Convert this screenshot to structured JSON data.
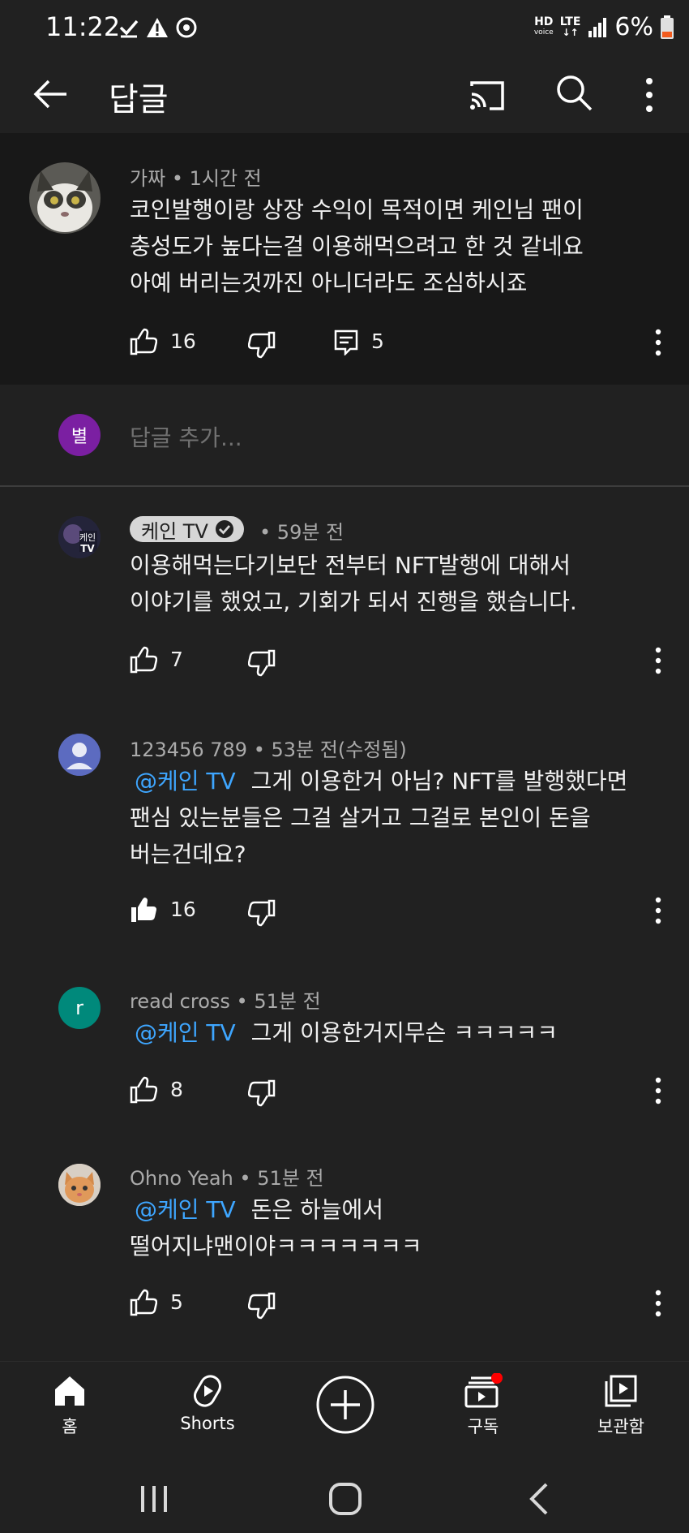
{
  "status": {
    "time": "11:22",
    "network_top": "HD",
    "network_bottom": "voice",
    "lte_top": "LTE",
    "battery": "6%"
  },
  "appbar": {
    "title": "답글"
  },
  "parent_comment": {
    "author": "가짜",
    "time": "1시간 전",
    "lines": [
      "코인발행이랑 상장 수익이 목적이면 케인님 팬이",
      "충성도가 높다는걸 이용해먹으려고 한 것 같네요",
      "아예 버리는것까진 아니더라도 조심하시죠"
    ],
    "likes": "16",
    "replies": "5"
  },
  "add_reply": {
    "avatar_letter": "별",
    "placeholder": "답글 추가..."
  },
  "replies": [
    {
      "author": "케인 TV",
      "time": "59분 전",
      "verified_channel": true,
      "lines": [
        "이용해먹는다기보단 전부터 NFT발행에 대해서",
        "이야기를 했었고, 기회가 되서 진행을 했습니다."
      ],
      "likes": "7"
    },
    {
      "author": "123456 789",
      "time": "53분 전(수정됨)",
      "mention": "@케인 TV",
      "line1_rest": "그게 이용한거 아님?  NFT를 발행했다면",
      "lines": [
        "팬심 있는분들은 그걸 살거고 그걸로 본인이 돈을",
        "버는건데요?"
      ],
      "likes": "16"
    },
    {
      "author": "read cross",
      "avatar_letter": "r",
      "time": "51분 전",
      "mention": "@케인 TV",
      "line1_rest": "그게 이용한거지무슨 ㅋㅋㅋㅋㅋ",
      "likes": "8"
    },
    {
      "author": "Ohno Yeah",
      "time": "51분 전",
      "mention": "@케인 TV",
      "line1_rest": "돈은 하늘에서",
      "lines": [
        "떨어지냐맨이야ㅋㅋㅋㅋㅋㅋㅋ"
      ],
      "likes": "5"
    }
  ],
  "bottom_nav": {
    "home": "홈",
    "shorts": "Shorts",
    "subscriptions": "구독",
    "library": "보관함"
  },
  "colors": {
    "background": "#212121",
    "parent_background": "#181818",
    "mention": "#3ea6ff",
    "meta": "#aaaaaa",
    "notification_dot": "#ff0000"
  }
}
